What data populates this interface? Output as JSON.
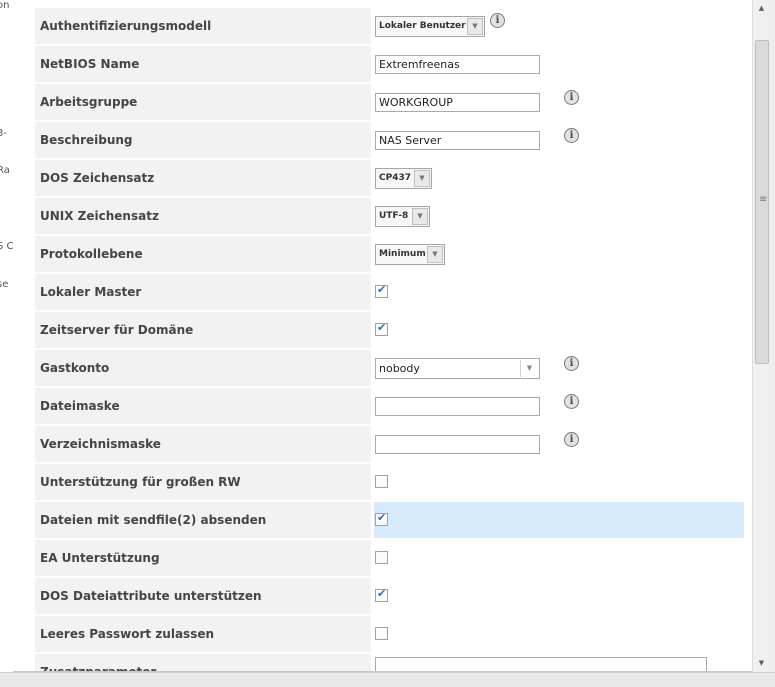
{
  "background_fragments": [
    "on",
    "3-",
    "Ra",
    "S C",
    "se"
  ],
  "form": {
    "rows": [
      {
        "label": "Authentifizierungsmodell",
        "type": "select",
        "value": "Lokaler Benutzer",
        "info": true
      },
      {
        "label": "NetBIOS Name",
        "type": "text",
        "value": "Extremfreenas",
        "info": false
      },
      {
        "label": "Arbeitsgruppe",
        "type": "text",
        "value": "WORKGROUP",
        "info": true
      },
      {
        "label": "Beschreibung",
        "type": "text",
        "value": "NAS Server",
        "info": true
      },
      {
        "label": "DOS Zeichensatz",
        "type": "select",
        "value": "CP437",
        "info": false
      },
      {
        "label": "UNIX Zeichensatz",
        "type": "select",
        "value": "UTF-8",
        "info": false
      },
      {
        "label": "Protokollebene",
        "type": "select",
        "value": "Minimum",
        "info": false
      },
      {
        "label": "Lokaler Master",
        "type": "checkbox",
        "checked": true
      },
      {
        "label": "Zeitserver für Domäne",
        "type": "checkbox",
        "checked": true
      },
      {
        "label": "Gastkonto",
        "type": "select-wide",
        "value": "nobody",
        "info": true
      },
      {
        "label": "Dateimaske",
        "type": "text",
        "value": "",
        "info": true
      },
      {
        "label": "Verzeichnismaske",
        "type": "text",
        "value": "",
        "info": true
      },
      {
        "label": "Unterstützung für großen RW",
        "type": "checkbox",
        "checked": false
      },
      {
        "label": "Dateien mit sendfile(2) absenden",
        "type": "checkbox",
        "checked": true,
        "highlighted": true
      },
      {
        "label": "EA Unterstützung",
        "type": "checkbox",
        "checked": false
      },
      {
        "label": "DOS Dateiattribute unterstützen",
        "type": "checkbox",
        "checked": true
      },
      {
        "label": "Leeres Passwort zulassen",
        "type": "checkbox",
        "checked": false
      },
      {
        "label": "Zusatzparameter",
        "type": "textarea",
        "value": ""
      }
    ]
  },
  "info_icon_glyph": "i",
  "scrollbar": {
    "up": "▲",
    "down": "▼",
    "grip": "≡"
  },
  "colors": {
    "label_bg": "#f2f2f2",
    "highlight_bg": "#d6eafb",
    "checkmark": "#3a6db3"
  }
}
